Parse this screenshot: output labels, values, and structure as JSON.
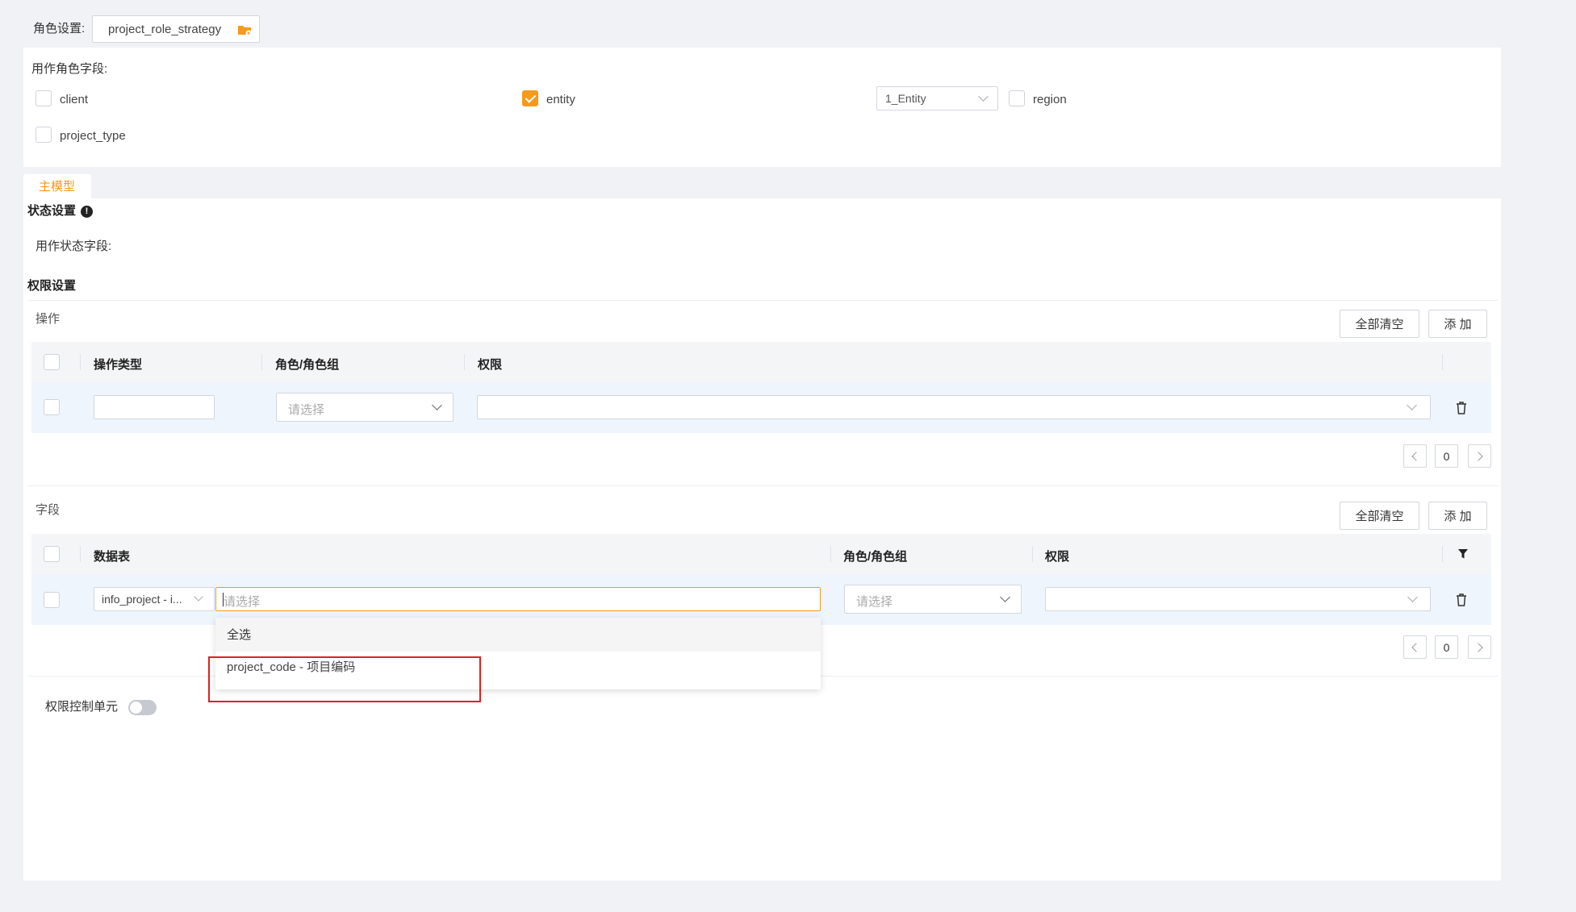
{
  "role_setting": {
    "label": "角色设置:",
    "value": "project_role_strategy"
  },
  "role_fields": {
    "label": "用作角色字段:",
    "items": [
      {
        "label": "client",
        "checked": false
      },
      {
        "label": "entity",
        "checked": true
      },
      {
        "label": "region",
        "checked": false
      },
      {
        "label": "project_type",
        "checked": false
      }
    ],
    "entity_select": "1_Entity"
  },
  "tabs": {
    "main_model": "主模型"
  },
  "status_settings": {
    "title": "状态设置",
    "field_label": "用作状态字段:"
  },
  "permission_settings": {
    "title": "权限设置",
    "operations": {
      "label": "操作",
      "clear_all": "全部清空",
      "add": "添 加",
      "columns": [
        "操作类型",
        "角色/角色组",
        "权限"
      ],
      "row": {
        "role_placeholder": "请选择"
      },
      "page": "0"
    },
    "fields": {
      "label": "字段",
      "clear_all": "全部清空",
      "add": "添 加",
      "columns": [
        "数据表",
        "角色/角色组",
        "权限"
      ],
      "row": {
        "table_value": "info_project - i...",
        "field_placeholder": "请选择",
        "role_placeholder": "请选择"
      },
      "dropdown": {
        "select_all": "全选",
        "option": "project_code - 项目编码"
      },
      "page": "0"
    },
    "control_unit": {
      "label": "权限控制单元",
      "enabled": false
    }
  }
}
